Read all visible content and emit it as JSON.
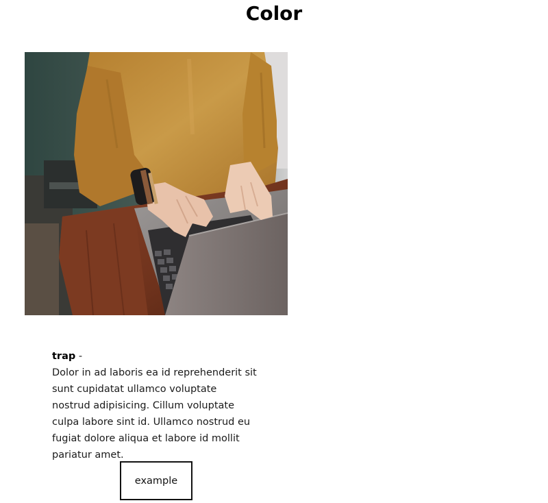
{
  "page": {
    "title": "Color"
  },
  "photo": {
    "subject": "person typing on laptop at wooden desk",
    "colors": {
      "sweater": "#c08a38",
      "desk": "#7a3a22",
      "laptop": "#8a8684",
      "background": "#3d524c"
    }
  },
  "card": {
    "term": "trap",
    "separator": " -",
    "description": "Dolor in ad laboris ea id reprehenderit sit sunt cupidatat ullamco voluptate nostrud adipisicing. Cillum voluptate culpa labore sint id. Ullamco nostrud eu fugiat dolore aliqua et labore id mollit pariatur amet."
  },
  "button": {
    "label": "example"
  }
}
